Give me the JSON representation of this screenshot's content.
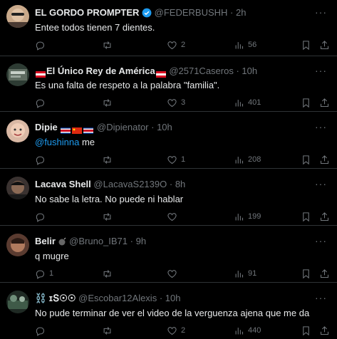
{
  "tweets": [
    {
      "name": "EL GORDO PROMPTER",
      "handle": "@FEDERBUSHH",
      "time": "2h",
      "text": "Entee todos tienen 7 dientes.",
      "replies": "",
      "retweets": "",
      "likes": "2",
      "views": "56",
      "verified": true
    },
    {
      "name": "El Único Rey de América",
      "handle": "@2571Caseros",
      "time": "10h",
      "text": "Es una falta de respeto a la palabra \"familia\".",
      "replies": "",
      "retweets": "",
      "likes": "3",
      "views": "401"
    },
    {
      "name": "Dipie",
      "handle": "@Dipienator",
      "time": "10h",
      "mention": "@fushinna",
      "text": " me",
      "replies": "",
      "retweets": "",
      "likes": "1",
      "views": "208"
    },
    {
      "name": "Lacava Shell",
      "handle": "@LacavaS2139O",
      "time": "8h",
      "text": "No sabe la letra. No puede ni hablar",
      "replies": "",
      "retweets": "",
      "likes": "",
      "views": "199"
    },
    {
      "name": "Belir",
      "handle": "@Bruno_IB71",
      "time": "9h",
      "text": "q mugre",
      "replies": "1",
      "retweets": "",
      "likes": "",
      "views": "91"
    },
    {
      "name": "⛓️ ɪՏ☉☉",
      "handle": "@Escobar12Alexis",
      "time": "10h",
      "text": "No pude terminar de ver el video de la verguenza ajena que me da",
      "replies": "",
      "retweets": "",
      "likes": "2",
      "views": "440"
    }
  ],
  "more_label": "···",
  "colors": {
    "accent": "#1d9bf0",
    "muted": "#71767b",
    "bg": "#000000",
    "text": "#e7e9ea"
  }
}
